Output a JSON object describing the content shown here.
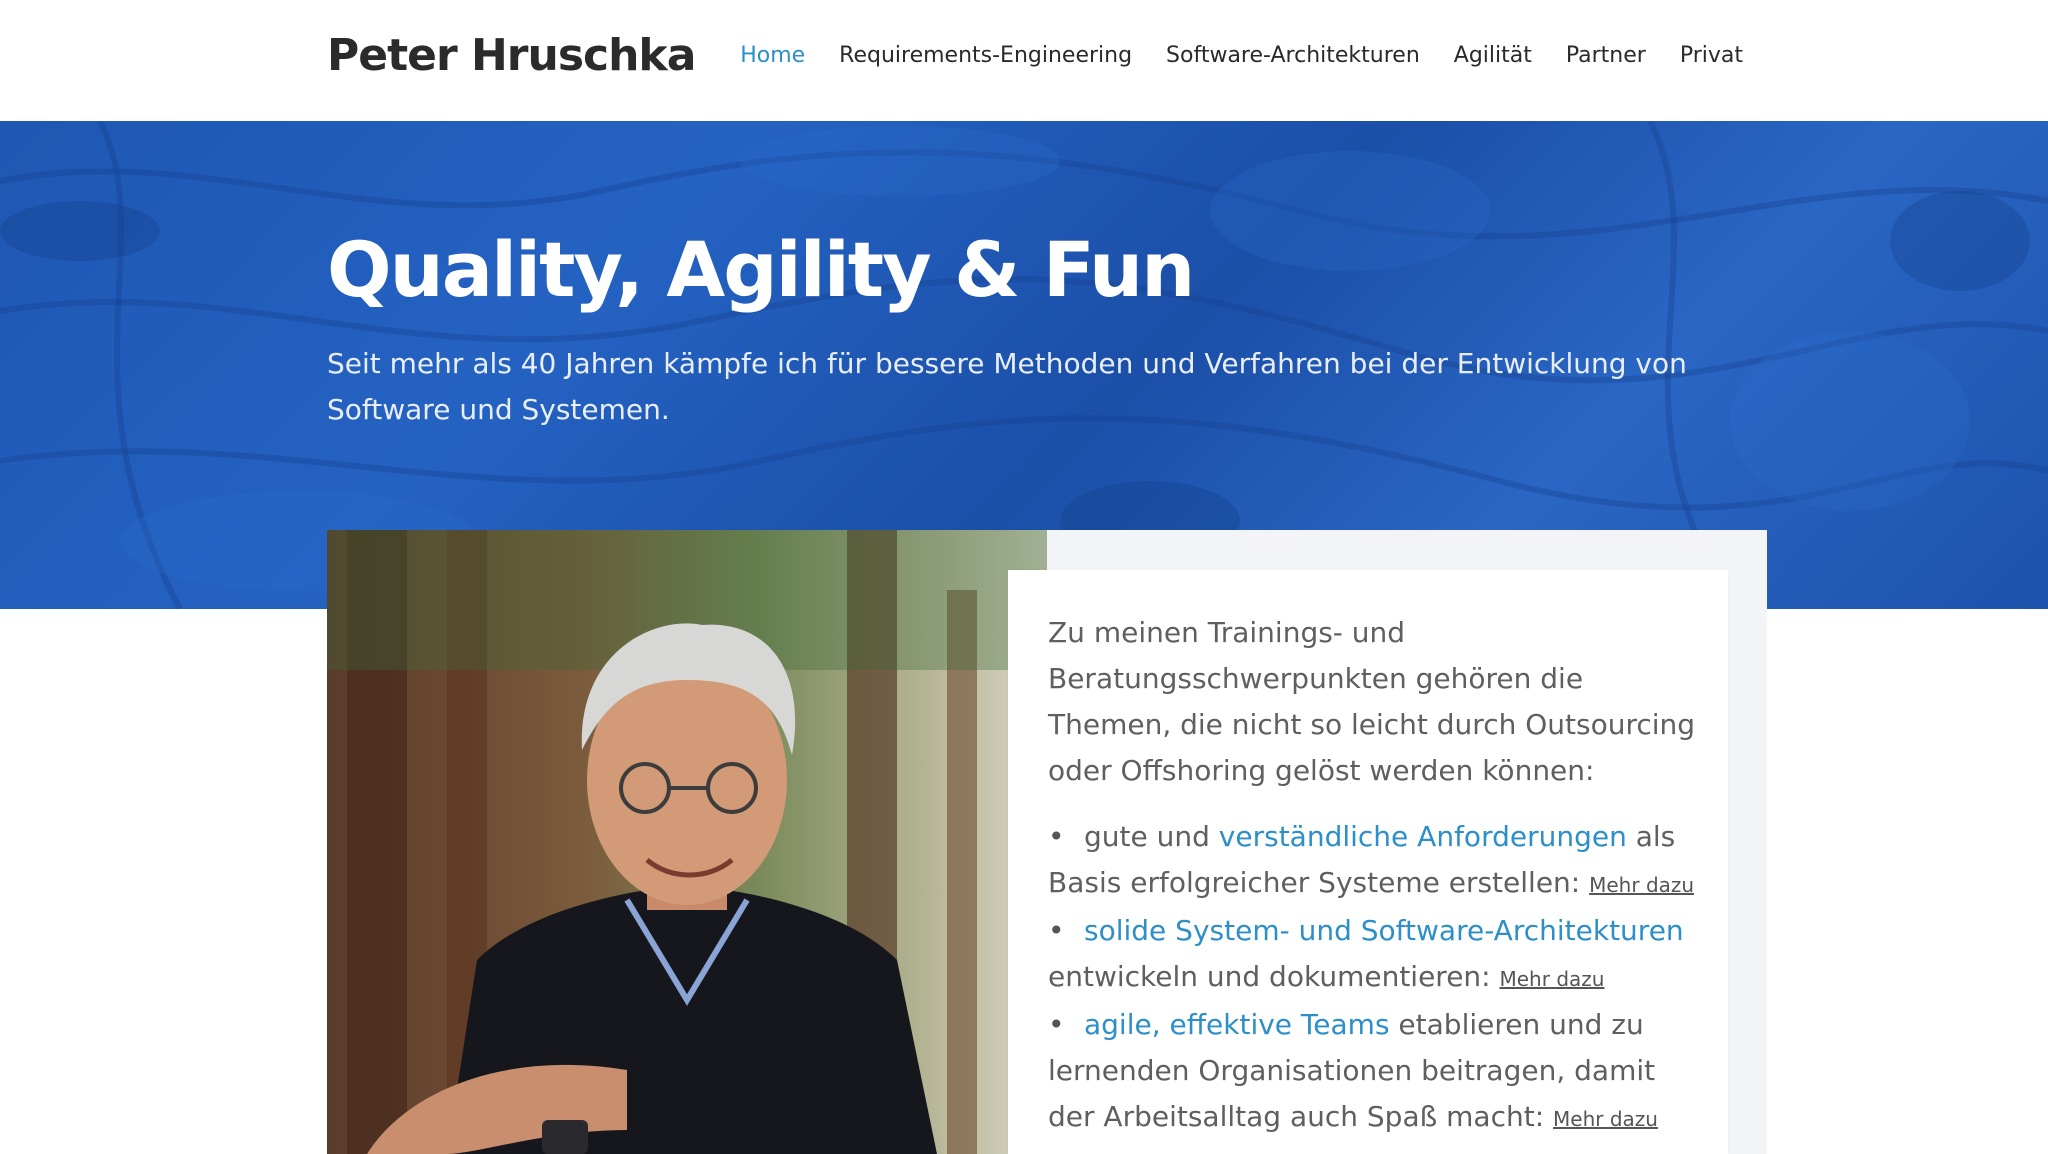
{
  "header": {
    "brand": "Peter Hruschka",
    "nav": [
      {
        "label": "Home",
        "active": true
      },
      {
        "label": "Requirements-Engineering",
        "active": false
      },
      {
        "label": "Software-Architekturen",
        "active": false
      },
      {
        "label": "Agilität",
        "active": false
      },
      {
        "label": "Partner",
        "active": false
      },
      {
        "label": "Privat",
        "active": false
      }
    ]
  },
  "hero": {
    "title": "Quality, Agility & Fun",
    "subtitle": "Seit mehr als 40 Jahren kämpfe ich für bessere Methoden und Verfahren bei der Entwicklung von Software und Systemen."
  },
  "card": {
    "intro": "Zu meinen Trainings- und Beratungsschwerpunkten gehören die Themen, die nicht so leicht durch Outsourcing oder Offshoring gelöst werden können:",
    "items": [
      {
        "before": "gute und ",
        "link": "verständliche Anforderungen",
        "after": " als Basis erfolgreicher Systeme erstellen: ",
        "more": "Mehr dazu"
      },
      {
        "before": "",
        "link": "solide System- und Software-Architekturen",
        "after": " entwickeln und dokumentieren: ",
        "more": "Mehr dazu"
      },
      {
        "before": "",
        "link": "agile, effektive Teams",
        "after": " etablieren und zu lernenden Organisationen beitragen, damit der Arbeitsalltag auch Spaß macht: ",
        "more": "Mehr dazu"
      }
    ]
  },
  "colors": {
    "accent": "#2d8fc9",
    "hero_blue": "#1f57b3",
    "brand_text": "#2b2b2b"
  }
}
